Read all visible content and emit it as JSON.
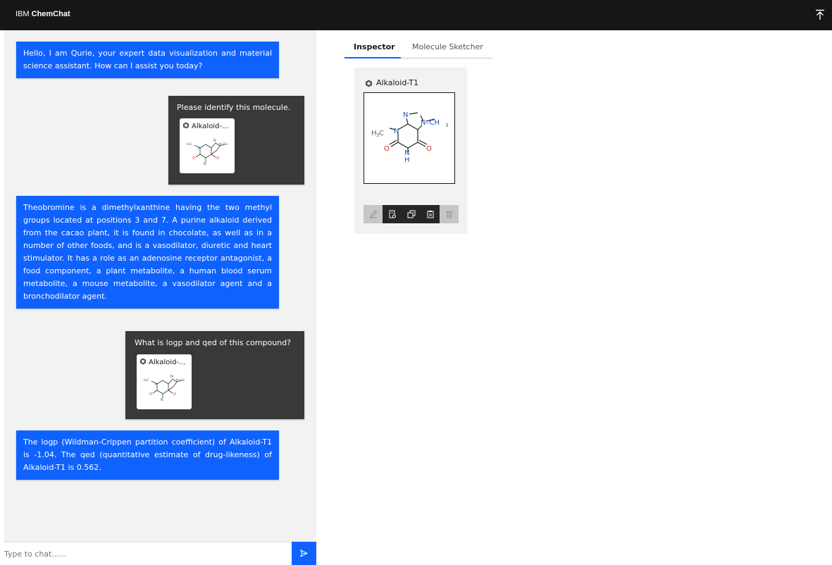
{
  "app": {
    "brand_prefix": "IBM",
    "brand_name": "ChemChat"
  },
  "colors": {
    "topbar": "#161616",
    "bot_bubble": "#0f62fe",
    "user_bubble": "#393939",
    "panel_bg": "#f2f2f2",
    "accent": "#0f62fe"
  },
  "messages": [
    {
      "role": "bot",
      "text": "Hello, I am Qurie, your expert data visualization and material science assistant. How can I assist you today?"
    },
    {
      "role": "user",
      "text": "Please identify this molecule.",
      "attachment": {
        "label": "Alkaloid-...",
        "icon": "molecule-icon"
      }
    },
    {
      "role": "bot",
      "text": "Theobromine is a dimethylxanthine having the two methyl groups located at positions 3 and 7. A purine alkaloid derived from the cacao plant, it is found in chocolate, as well as in a number of other foods, and is a vasodilator, diuretic and heart stimulator. It has a role as an adenosine receptor antagonist, a food component, a plant metabolite, a human blood serum metabolite, a mouse metabolite, a vasodilator agent and a bronchodilator agent."
    },
    {
      "role": "user",
      "text": "What is logp and qed of this compound?",
      "attachment": {
        "label": "Alkaloid-...",
        "icon": "molecule-icon"
      }
    },
    {
      "role": "bot",
      "text": "The logp (Wildman-Crippen partition coefficient) of Alkaloid-T1 is -1.04. The qed (quantitative estimate of drug-likeness) of Alkaloid-T1 is 0.562."
    }
  ],
  "chat_input": {
    "placeholder": "Type to chat......",
    "value": ""
  },
  "tabs": [
    {
      "label": "Inspector",
      "active": true
    },
    {
      "label": "Molecule Sketcher",
      "active": false
    }
  ],
  "inspector": {
    "molecule_name": "Alkaloid-T1",
    "toolbar": [
      "edit-icon",
      "notebook-icon",
      "copy-icon",
      "paste-icon",
      "delete-icon"
    ]
  },
  "structure_labels": {
    "n_top": "N",
    "n_methyl": "N–CH",
    "n_methyl_sub": "3",
    "h3c": "H",
    "h3c_sub": "3",
    "h3c_c": "C",
    "n_left": "N",
    "o_left": "O",
    "n_bottom": "N",
    "h_bottom": "H",
    "o_right": "O"
  }
}
